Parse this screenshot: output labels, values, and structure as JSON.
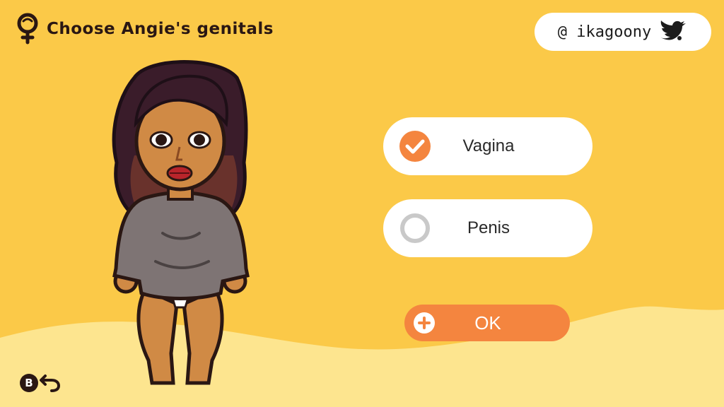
{
  "header": {
    "title": "Choose Angie's genitals",
    "icon": "gender-icon"
  },
  "social": {
    "handle": "@ ikagoony",
    "icon": "twitter-bird-icon"
  },
  "options": [
    {
      "label": "Vagina",
      "selected": true
    },
    {
      "label": "Penis",
      "selected": false
    }
  ],
  "confirm": {
    "label": "OK",
    "icon": "plus-circle-icon"
  },
  "footer": {
    "back_button_glyph": "B",
    "back_icon": "back-arrow-icon"
  },
  "colors": {
    "background": "#fbc948",
    "ground": "#fde58f",
    "accent": "#f4853f",
    "radio_unselected": "#c9c9c9",
    "pill": "#ffffff",
    "dark_text": "#2a1713"
  }
}
